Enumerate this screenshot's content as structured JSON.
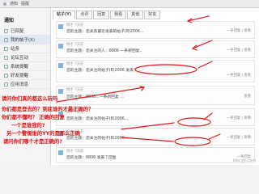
{
  "topbar": {
    "crumb1": "通知",
    "crumb2": "提醒"
  },
  "sidebar": {
    "title": "通知",
    "items": [
      {
        "label": "已回复"
      },
      {
        "label": "我的帖子(X)"
      },
      {
        "label": "站务"
      },
      {
        "label": "论坛互动"
      },
      {
        "label": "系统提醒"
      },
      {
        "label": "好友提醒"
      },
      {
        "label": "应用消息"
      }
    ]
  },
  "tabs": [
    "帖子(Y)",
    "点评",
    "回复",
    "我看",
    "其他",
    "好友"
  ],
  "messages": [
    {
      "date": "刚才  7天前",
      "line": "您的主题：您关系最近发表的帖子(8)2006...",
      "foot": "一条回复  |  查看"
    },
    {
      "date": "刚才  7天前",
      "line": "您的主题：您关注的人：8806 一条新回复..",
      "foot": "一条回复  |  查看"
    },
    {
      "date": "刚才  7天前",
      "line": "您的主题：您关注的帖子(8)2006 发表了 ...",
      "foot": "一条回复  |  查看"
    },
    {
      "date": "刚才  7天前",
      "line": "您的主题：8806...一条新回复 ...",
      "foot": "查看"
    },
    {
      "date": "刚才  7天前",
      "line": "您的主题：您关注的帖子(8)2006...",
      "foot": "一条回复  |  查看"
    },
    {
      "date": "刚才  7天前",
      "line": "您的主题：您关注的帖子(8)2006...",
      "foot": "一条回复  |  查看"
    },
    {
      "date": "刚才  7天前",
      "line": "您的主题：8806 发表了回复",
      "foot": "一条回复"
    }
  ],
  "annotations": {
    "note1": "请问你们真的都这么玩吗",
    "note2": "你们都是登去的？到底谁的才最正确的？",
    "note3": "你们都不懂吗？ 正确的回复",
    "note4": "一个是谁我的?",
    "note5": "另一个警惕谁的YY的是那么正确",
    "note6": "请问你们哪个才是正确的?"
  },
  "watermark": "bbs.yy.com"
}
